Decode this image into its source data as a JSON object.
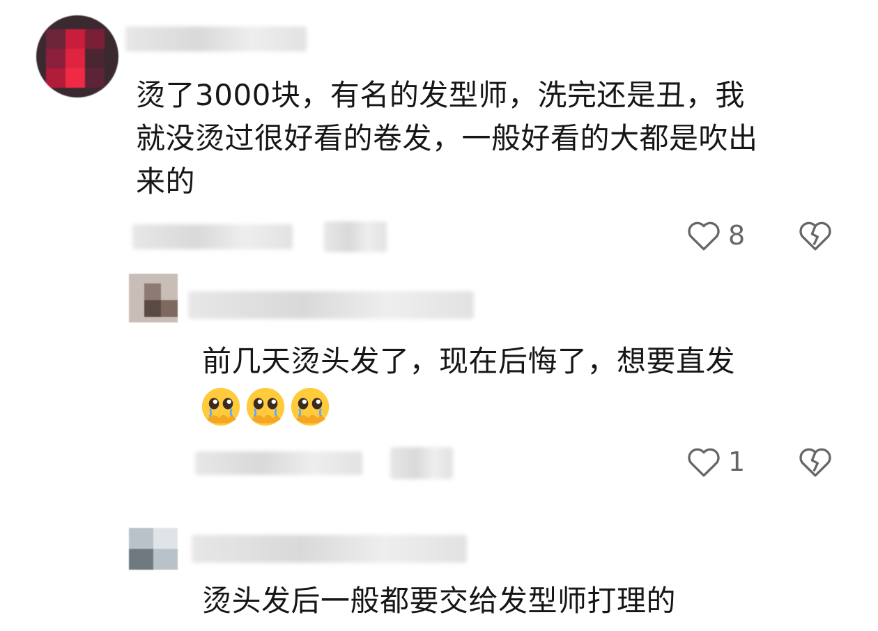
{
  "comments": [
    {
      "text": "烫了3000块，有名的发型师，洗完还是丑，我\n就没烫过很好看的卷发，一般好看的大都是吹出\n来的",
      "like_count": "8"
    },
    {
      "text": "前几天烫头发了，现在后悔了，想要直发",
      "emoji_count_display": "3",
      "like_count": "1"
    },
    {
      "text": "烫头发后一般都要交给发型师打理的"
    }
  ],
  "icons": {
    "like": "heart-outline-icon",
    "dislike": "broken-heart-icon",
    "emoji": "pleading-face-emoji"
  },
  "colors": {
    "text": "#161616",
    "icon": "#666666",
    "emoji_face": "#FFCB3D"
  }
}
